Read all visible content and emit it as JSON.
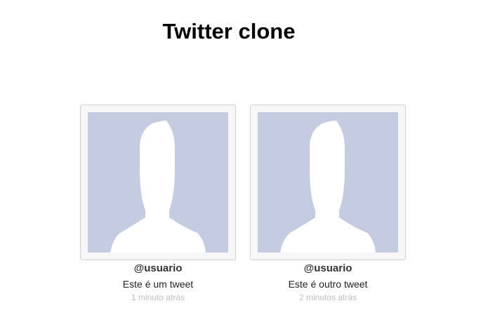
{
  "page": {
    "title": "Twitter clone"
  },
  "tweets": [
    {
      "username": "@usuario",
      "text": "Este é um tweet",
      "time": "1 minuto atrás",
      "avatar_icon": "default-profile-silhouette-icon"
    },
    {
      "username": "@usuario",
      "text": "Este é outro tweet",
      "time": "2 minutos atrás",
      "avatar_icon": "default-profile-silhouette-icon"
    }
  ],
  "colors": {
    "avatar_bg": "#c3cce0",
    "silhouette": "#ffffff",
    "timestamp": "#bdbdbd"
  }
}
